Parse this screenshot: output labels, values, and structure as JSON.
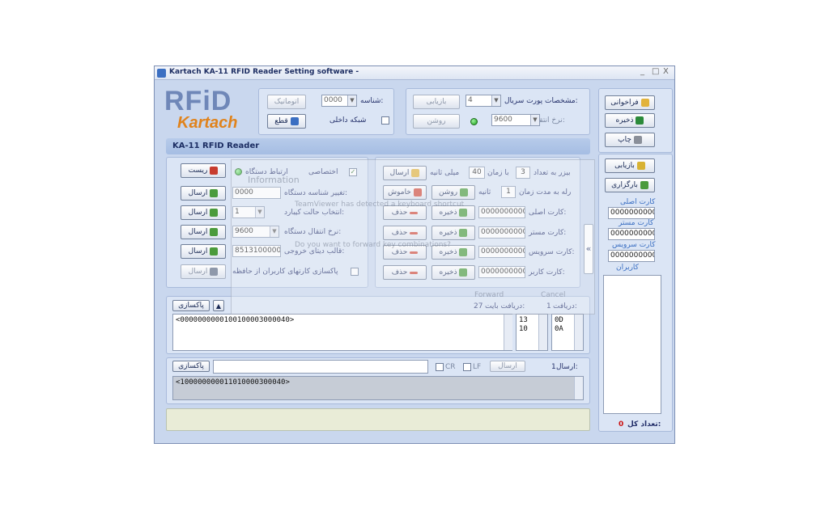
{
  "window": {
    "title": "Kartach KA-11 RFID Reader Setting software -",
    "controls": [
      "_",
      "□",
      "X"
    ]
  },
  "logo": {
    "top": "RFiD",
    "bottom": "Kartach"
  },
  "top_left": {
    "id_label": "شناسه:",
    "id_value": "0000",
    "auto_button": "اتوماتیک",
    "network_label": "شبکه داخلی",
    "disconnect_button": "قطع"
  },
  "serial_port": {
    "port_label": "مشخصات پورت سریال:",
    "port_value": "4",
    "refresh_button": "بازیابی",
    "baud_label": "نرخ انتقال:",
    "baud_value": "9600",
    "on_button": "روشن"
  },
  "right_bar": {
    "load_button": "فراخوانی",
    "save_button": "ذخیره",
    "print_button": "چاپ",
    "refresh_button": "بازیابی",
    "upload_button": "بارگزاری",
    "main_card_label": "کارت اصلی",
    "main_card_value": "0000000000",
    "master_card_label": "کارت مستر",
    "master_card_value": "0000000000",
    "service_card_label": "کارت سرویس",
    "service_card_value": "0000000000",
    "users_label": "کاربران",
    "total_label": "تعداد کل:",
    "total_value": "0"
  },
  "section_title": "KA-11 RFID Reader",
  "device": {
    "reset_button": "ریست",
    "connection_label": "ارتباط دستگاه",
    "private_label": "اختصاصی",
    "send_label": "ارسال",
    "change_id_label": "تغییر شناسه دستگاه:",
    "change_id_value": "0000",
    "mode_label": "انتخاب حالت کیبارد:",
    "mode_value": "1",
    "baud_label": "نرخ انتقال دستگاه:",
    "baud_value": "9600",
    "output_label": "قالب دیتای خروجی:",
    "output_value": "8513100000",
    "clear_users_label": "پاکسازی کارتهای کاربران از حافظه"
  },
  "buzzer": {
    "buzzer_label": "بیزر به تعداد",
    "count": "3",
    "time_label": "با زمان",
    "time_value": "40",
    "ms_label": "میلی ثانیه",
    "send_button": "ارسال",
    "relay_label": "رله به مدت زمان",
    "relay_value": "1",
    "sec_label": "ثانیه",
    "on_button": "روشن",
    "off_button": "خاموش"
  },
  "cards": [
    {
      "label": "کارت اصلی:",
      "value": "0000000000",
      "save": "ذخیره",
      "delete": "حذف"
    },
    {
      "label": "کارت مستر:",
      "value": "0000000000",
      "save": "ذخیره",
      "delete": "حذف"
    },
    {
      "label": "کارت سرویس:",
      "value": "0000000000",
      "save": "ذخیره",
      "delete": "حذف"
    },
    {
      "label": "کارت کاربر:",
      "value": "0000000000",
      "save": "ذخیره",
      "delete": "حذف"
    }
  ],
  "receive": {
    "clear_button": "پاکسازی",
    "received_label": "دریافت:",
    "received_value": "1",
    "bytes_label": "دریافت بایت:",
    "bytes_value": "27",
    "data": "<0000000000100100003000040>",
    "hex1": [
      "13",
      "10"
    ],
    "hex2": [
      "0D",
      "0A"
    ]
  },
  "send": {
    "clear_button": "پاکسازی",
    "cr_label": "CR",
    "lf_label": "LF",
    "send_button": "ارسال",
    "sent_label": "ارسال:",
    "sent_value": "1",
    "data": "<100000000011010000300040>"
  },
  "overlay": {
    "title": "Information",
    "line1": "TeamViewer has detected a keyboard shortcut",
    "line2": "Do you want to forward key combinations?",
    "forward": "Forward",
    "cancel": "Cancel"
  },
  "colors": {
    "accent": "#3b6fc2",
    "led_green": "#19a319",
    "window_bg": "#c9d7ee"
  }
}
